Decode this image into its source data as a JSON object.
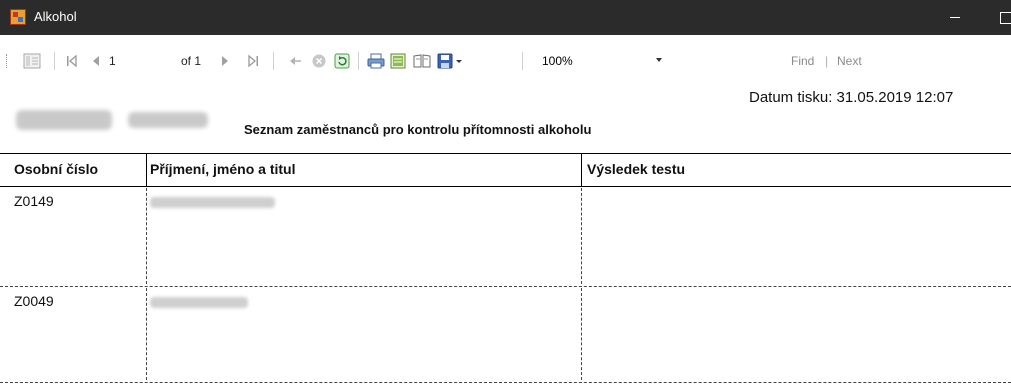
{
  "window": {
    "title": "Alkohol"
  },
  "toolbar": {
    "page_current": "1",
    "page_of": "of 1",
    "zoom": "100%",
    "find": "Find",
    "find_sep": "|",
    "next": "Next"
  },
  "report": {
    "print_date": "Datum tisku: 31.05.2019 12:07",
    "title": "Seznam zaměstnanců pro kontrolu přítomnosti alkoholu",
    "columns": [
      "Osobní číslo",
      "Příjmení, jméno a titul",
      "Výsledek testu"
    ],
    "rows": [
      {
        "id": "Z0149"
      },
      {
        "id": "Z0049"
      }
    ]
  }
}
